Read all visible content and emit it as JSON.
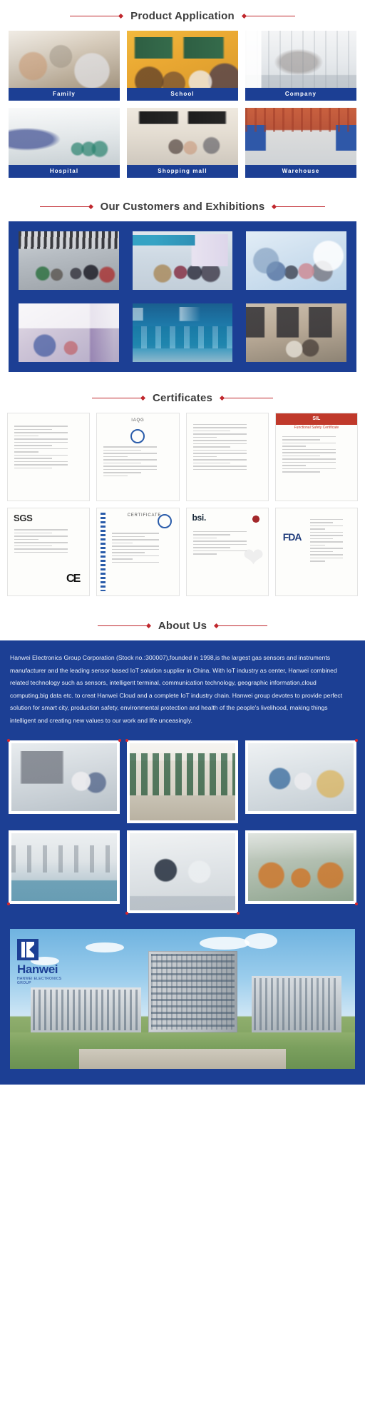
{
  "sections": {
    "product_application": {
      "title": "Product Application",
      "items": [
        {
          "caption": "Family",
          "photo": "living-room-family-photo"
        },
        {
          "caption": "School",
          "photo": "classroom-students-photo"
        },
        {
          "caption": "Company",
          "photo": "office-meeting-room-photo"
        },
        {
          "caption": "Hospital",
          "photo": "hospital-corridor-photo"
        },
        {
          "caption": "Shopping mall",
          "photo": "shopping-mall-interior-photo"
        },
        {
          "caption": "Warehouse",
          "photo": "warehouse-racking-photo"
        }
      ]
    },
    "customers_exhibitions": {
      "title": "Our Customers and Exhibitions",
      "items": [
        {
          "photo": "exhibition-showroom-visitors-photo"
        },
        {
          "photo": "exhibition-booth-crowd-photo"
        },
        {
          "photo": "exhibition-group-portrait-photo"
        },
        {
          "photo": "exhibition-banner-booth-photo"
        },
        {
          "photo": "exhibition-blue-booth-photo"
        },
        {
          "photo": "exhibition-delegation-group-photo"
        }
      ]
    },
    "certificates": {
      "title": "Certificates",
      "items": [
        {
          "issuer": "",
          "label": "attestation-certificate-scan",
          "style": "plain-text"
        },
        {
          "issuer": "IAQG",
          "label": "attestation-of-conformity-scan",
          "style": "iaqg"
        },
        {
          "issuer": "",
          "label": "certificate-of-registration-scan",
          "style": "plain-text"
        },
        {
          "issuer": "SIL",
          "label": "functional-safety-certificate-scan",
          "style": "sil",
          "title": "SIL",
          "subtitle": "Functional Safety Certificate"
        },
        {
          "issuer": "SGS",
          "label": "sgs-verification-of-compliance-scan",
          "style": "sgs",
          "marks": "CE"
        },
        {
          "issuer": "",
          "label": "certificate-blue-border-scan",
          "style": "blue-strip",
          "title": "CERTIFICATE"
        },
        {
          "issuer": "bsi.",
          "label": "bsi-kitemark-certificate-scan",
          "style": "bsi"
        },
        {
          "issuer": "FDA",
          "label": "fda-establishment-registration-scan",
          "style": "fda"
        }
      ]
    },
    "about_us": {
      "title": "About Us",
      "body": "Hanwei Electronics Group Corporation (Stock no.:300007),founded in 1998,is the largest gas sensors and instruments manufacturer and the leading sensor-based IoT solution supplier in China. With IoT industry as center, Hanwei combined related technology such as sensors, intelligent terminal, communication technology, geographic information,cloud computing,big data etc. to creat Hanwei Cloud and a complete IoT industry chain. Hanwei group devotes to provide perfect solution for smart city, production safety, environmental protection and health of the people's livelihood, making things intelligent and creating new values to our work and life unceasingly.",
      "factory_photos": [
        {
          "photo": "smt-production-line-photo"
        },
        {
          "photo": "warehouse-aisles-photo"
        },
        {
          "photo": "assembly-workshop-photo"
        },
        {
          "photo": "calibration-lab-photo"
        },
        {
          "photo": "quality-inspection-bench-photo"
        },
        {
          "photo": "sensor-coil-winding-photo"
        }
      ],
      "banner": {
        "logo_text": "Hanwei",
        "logo_sub": "HANWEI ELECTRONICS GROUP",
        "photo": "hanwei-headquarters-building-photo"
      }
    }
  },
  "colors": {
    "brand_blue": "#1c3f94",
    "accent_red": "#c0272d",
    "heading_gray": "#3c3c3c",
    "page_bg": "#ffffff"
  }
}
